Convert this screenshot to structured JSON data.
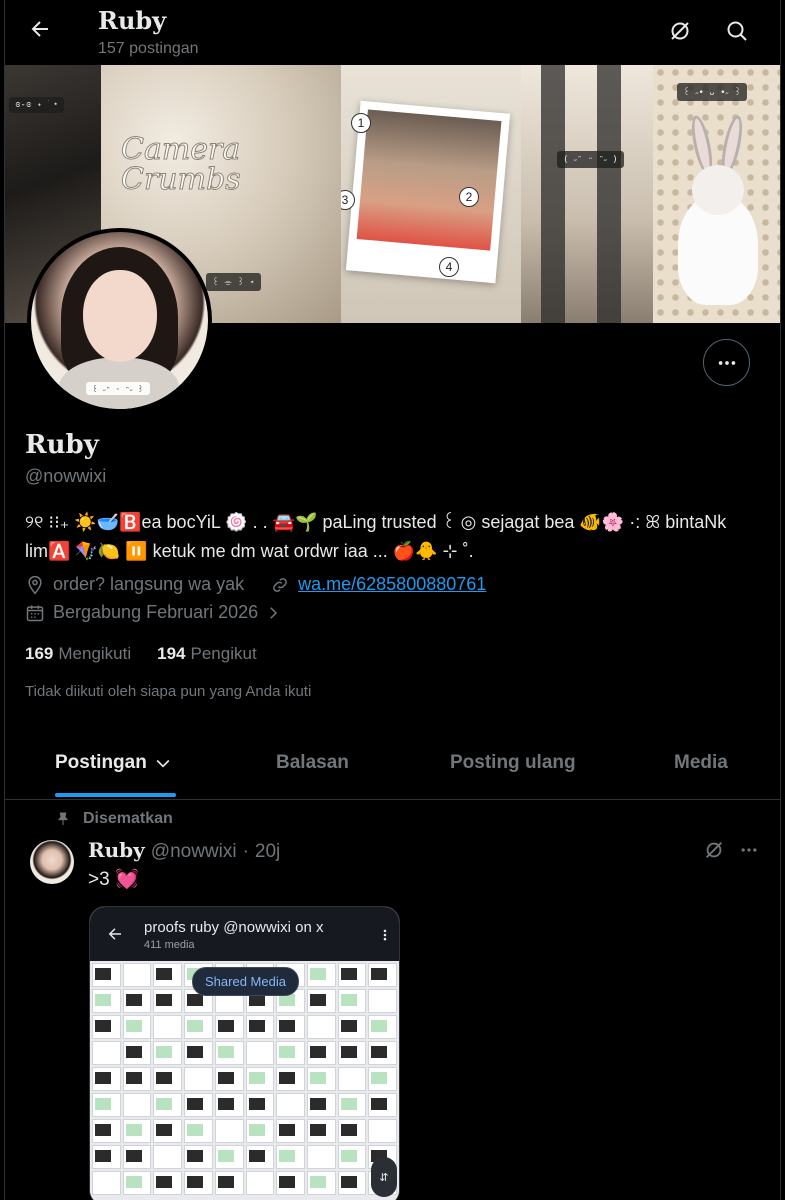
{
  "header": {
    "title": "Ruby",
    "post_count": "157 postingan"
  },
  "banner": {
    "sticker_1": "ɞ-ɞ ˖ ࣪ ⋆",
    "camera_text": "Camera\nCrumbs",
    "sticker_2": "꒰ ⌯ ꒱ ⋆",
    "sticker_3": "( ˶ᵔ ᵕ ᵔ˶ )",
    "sticker_4": "꒰ ˶• ᴗ •˶ ꒱",
    "photo_numbers": [
      "1",
      "2",
      "3",
      "4"
    ]
  },
  "profile": {
    "avatar_tag": "꒰ ˶ᵔ ᵕ ᵔ˶ ꒱",
    "name": "Ruby",
    "handle": "@nowwixi",
    "bio": "୨୧ ⁝⁝₊ ☀️🥣🅱️ea bocYiL 🍥 . . 🚘🌱 paLing trusted ꒰ ◎ sejagat bea 🐠🌸 ·: ꕤ bintaNk lim🅰️ 🪁🍋 ⏸️ ketuk me dm wat ordwr iaa ... 🍎🐥 ⊹ ˚.",
    "location": "order? langsung wa yak",
    "link": "wa.me/6285800880761",
    "joined": "Bergabung Februari 2026",
    "following_count": "169",
    "following_label": "Mengikuti",
    "followers_count": "194",
    "followers_label": "Pengikut",
    "not_followed_note": "Tidak diikuti oleh siapa pun yang Anda ikuti"
  },
  "tabs": [
    {
      "label": "Postingan",
      "active": true
    },
    {
      "label": "Balasan",
      "active": false
    },
    {
      "label": "Posting ulang",
      "active": false
    },
    {
      "label": "Media",
      "active": false
    }
  ],
  "post": {
    "pinned_label": "Disematkan",
    "author_name": "Ruby",
    "author_handle": "@nowwixi",
    "separator": "·",
    "time": "20j",
    "text": ">3 💓",
    "media": {
      "title": "proofs ruby @nowwixi on x",
      "subtitle": "411 media",
      "pill": "Shared Media"
    }
  },
  "colors": {
    "background": "#000000",
    "text": "#e7e9ea",
    "muted": "#71767b",
    "accent": "#1d9bf0",
    "border": "#2f3336"
  },
  "icons": {
    "back": "arrow-left-icon",
    "grok": "grok-icon",
    "search": "search-icon",
    "more": "more-horizontal-icon",
    "location": "location-pin-icon",
    "link": "link-icon",
    "calendar": "calendar-icon",
    "pin": "pin-icon",
    "chevron": "chevron-down-icon"
  }
}
